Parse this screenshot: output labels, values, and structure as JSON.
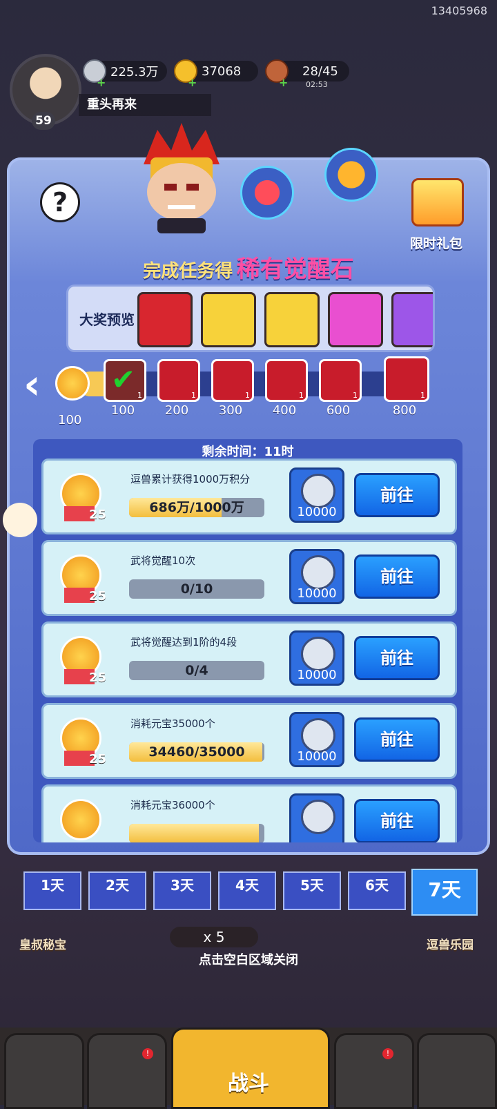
{
  "hud": {
    "user_id": "13405968",
    "level": "59",
    "silver": "225.3万",
    "gold": "37068",
    "stamina": "28/45",
    "stamina_timer": "02:53",
    "restart_label": "重头再来"
  },
  "event": {
    "help": "?",
    "gift_label": "限时礼包",
    "title_prefix": "完成任务得",
    "title_highlight": "稀有觉醒石",
    "preview_label": "大奖预览",
    "current_points": "100",
    "milestones": [
      {
        "value": "100",
        "count": "1",
        "claimed": true
      },
      {
        "value": "200",
        "count": "1",
        "claimed": false
      },
      {
        "value": "300",
        "count": "1",
        "claimed": false
      },
      {
        "value": "400",
        "count": "1",
        "claimed": false
      },
      {
        "value": "600",
        "count": "1",
        "claimed": false
      },
      {
        "value": "800",
        "count": "1",
        "claimed": false
      }
    ],
    "remaining_time": "剩余时间：11时",
    "tasks": [
      {
        "desc": "逗兽累计获得1000万积分",
        "progress": "686万/1000万",
        "fraction": 0.686,
        "points": "25",
        "reward_qty": "10000",
        "go": "前往"
      },
      {
        "desc": "武将觉醒10次",
        "progress": "0/10",
        "fraction": 0,
        "points": "25",
        "reward_qty": "10000",
        "go": "前往"
      },
      {
        "desc": "武将觉醒达到1阶的4段",
        "progress": "0/4",
        "fraction": 0,
        "points": "25",
        "reward_qty": "10000",
        "go": "前往"
      },
      {
        "desc": "消耗元宝35000个",
        "progress": "34460/35000",
        "fraction": 0.985,
        "points": "25",
        "reward_qty": "10000",
        "go": "前往"
      },
      {
        "desc": "消耗元宝36000个",
        "progress": "",
        "fraction": 0.96,
        "points": "",
        "reward_qty": "",
        "go": "前往"
      }
    ],
    "days": [
      "1天",
      "2天",
      "3天",
      "4天",
      "5天",
      "6天",
      "7天"
    ],
    "active_day": "7天",
    "close_hint": "点击空白区域关闭"
  },
  "background": {
    "left_label": "皇叔秘宝",
    "right_label": "逗兽乐园",
    "fight_cost": "x 5",
    "nav_center": "战斗"
  },
  "colors": {
    "panel": "#5c75d0",
    "go_button": "#1f7ff0",
    "title_highlight": "#ff4ea4",
    "progress_fill": "#f3be3d"
  }
}
